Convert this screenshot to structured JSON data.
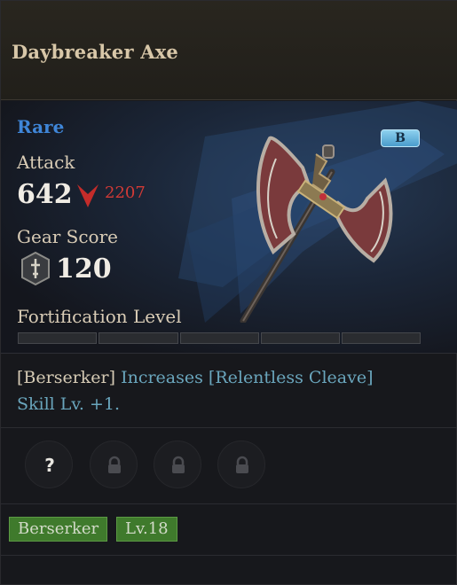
{
  "item": {
    "name": "Daybreaker Axe",
    "rarity": "Rare",
    "grade": "B",
    "attack_label": "Attack",
    "attack_value": "642",
    "attack_compare": "2207",
    "gear_score_label": "Gear Score",
    "gear_score_value": "120",
    "fortification_label": "Fortification Level",
    "fortification_level": 0,
    "fortification_max": 5,
    "skill_class": "[Berserker]",
    "skill_effect": "Increases [Relentless Cleave] Skill Lv. +1.",
    "skill_effect_line1": "Increases [Relentless Cleave]",
    "skill_effect_line2": "Skill Lv. +1.",
    "sockets": [
      "question-icon",
      "lock-icon",
      "lock-icon",
      "lock-icon"
    ],
    "tags": [
      "Berserker",
      "Lv.18"
    ]
  },
  "colors": {
    "rarity": "#3f86d8",
    "decrease": "#d23a36",
    "tag_bg": "#3f7a2c",
    "skill_effect": "#6aa6bd"
  }
}
